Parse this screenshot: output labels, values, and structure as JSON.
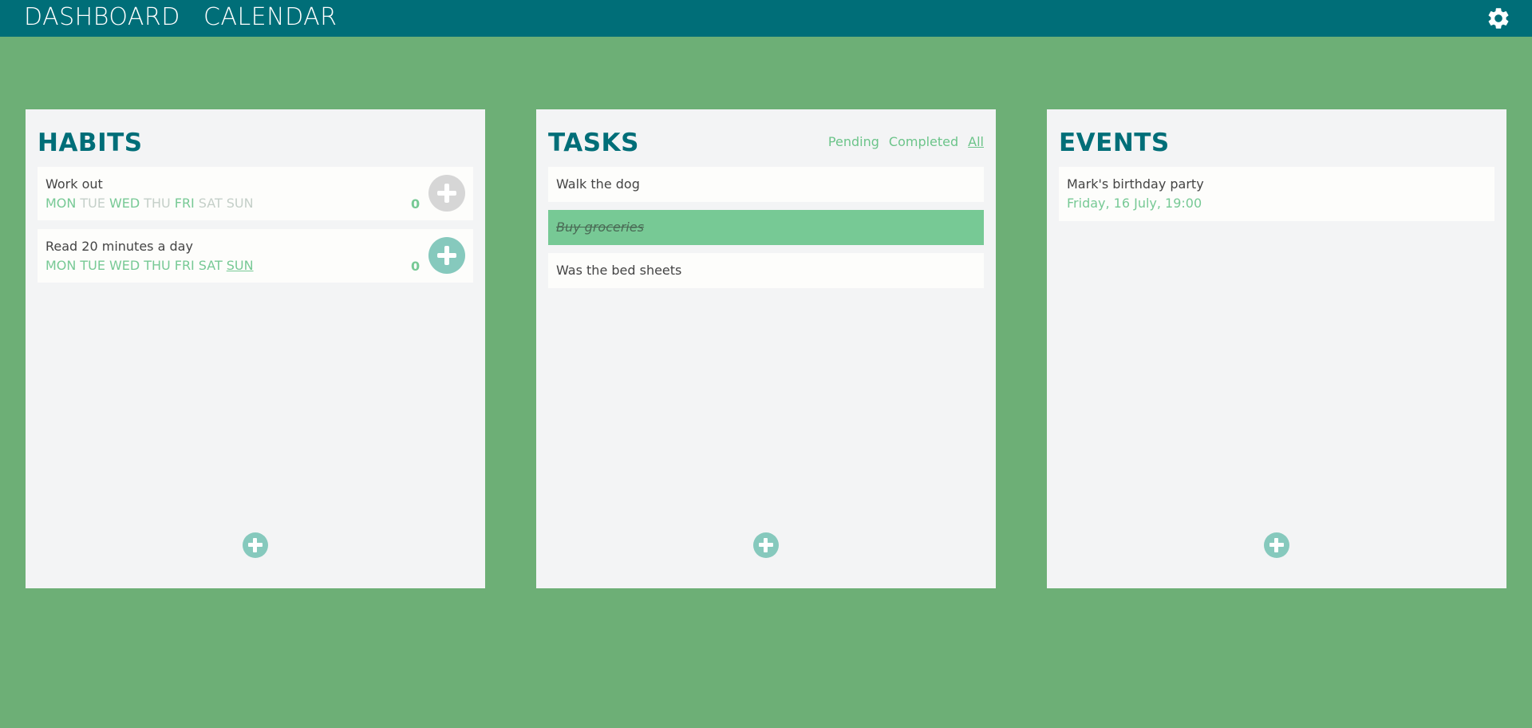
{
  "nav": {
    "dashboard": "DASHBOARD",
    "calendar": "CALENDAR",
    "settings_icon": "gear-icon"
  },
  "habits": {
    "title": "HABITS",
    "items": [
      {
        "name": "Work out",
        "count": "0",
        "button_state": "inactive",
        "days": [
          {
            "label": "MON",
            "active": true,
            "today": false
          },
          {
            "label": "TUE",
            "active": false,
            "today": false
          },
          {
            "label": "WED",
            "active": true,
            "today": false
          },
          {
            "label": "THU",
            "active": false,
            "today": false
          },
          {
            "label": "FRI",
            "active": true,
            "today": false
          },
          {
            "label": "SAT",
            "active": false,
            "today": false
          },
          {
            "label": "SUN",
            "active": false,
            "today": false
          }
        ]
      },
      {
        "name": "Read 20 minutes a day",
        "count": "0",
        "button_state": "active",
        "days": [
          {
            "label": "MON",
            "active": true,
            "today": false
          },
          {
            "label": "TUE",
            "active": true,
            "today": false
          },
          {
            "label": "WED",
            "active": true,
            "today": false
          },
          {
            "label": "THU",
            "active": true,
            "today": false
          },
          {
            "label": "FRI",
            "active": true,
            "today": false
          },
          {
            "label": "SAT",
            "active": true,
            "today": false
          },
          {
            "label": "SUN",
            "active": true,
            "today": true
          }
        ]
      }
    ]
  },
  "tasks": {
    "title": "TASKS",
    "filters": [
      {
        "label": "Pending",
        "active": false
      },
      {
        "label": "Completed",
        "active": false
      },
      {
        "label": "All",
        "active": true
      }
    ],
    "items": [
      {
        "text": "Walk the dog",
        "done": false
      },
      {
        "text": "Buy groceries",
        "done": true
      },
      {
        "text": "Was the bed sheets",
        "done": false
      }
    ]
  },
  "events": {
    "title": "EVENTS",
    "items": [
      {
        "title": "Mark's birthday party",
        "date": "Friday, 16 July, 19:00"
      }
    ]
  },
  "colors": {
    "background": "#6daf76",
    "topbar": "#006e78",
    "accent_green": "#77c995",
    "accent_teal": "#86c9bd"
  }
}
